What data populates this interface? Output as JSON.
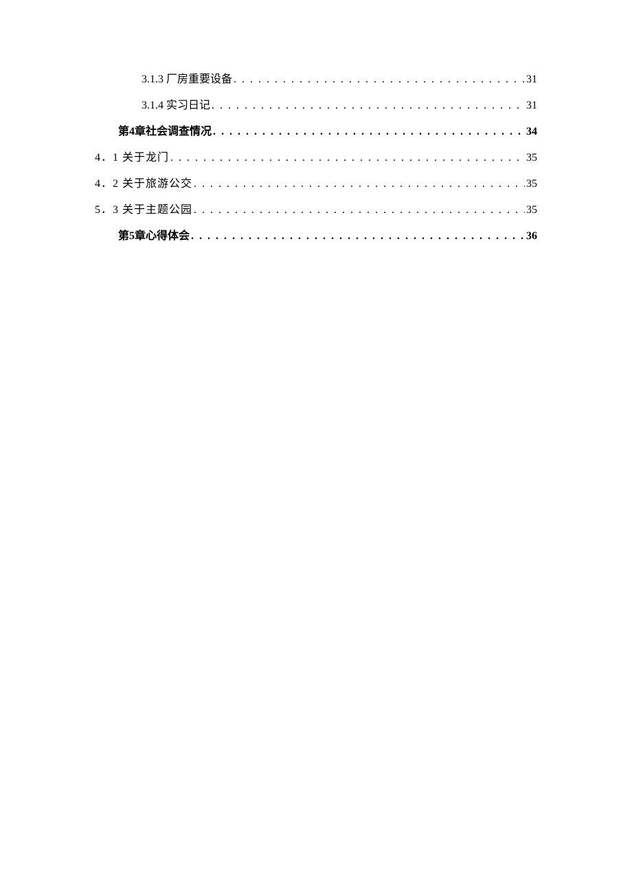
{
  "toc": {
    "entries": [
      {
        "indent": "indent-1",
        "bold": false,
        "label": "3.1.3  厂房重要设备",
        "page": "31"
      },
      {
        "indent": "indent-1",
        "bold": false,
        "label": "3.1.4  实习日记",
        "page": "31"
      },
      {
        "indent": "indent-2",
        "bold": true,
        "label": "第4章社会调查情况",
        "page": "34"
      },
      {
        "indent": "indent-0",
        "bold": false,
        "label": "4．1  关于龙门",
        "page": "35"
      },
      {
        "indent": "indent-0",
        "bold": false,
        "label": "4．2  关于旅游公交",
        "page": "35"
      },
      {
        "indent": "indent-0",
        "bold": false,
        "label": "5．3  关于主题公园",
        "page": "35"
      },
      {
        "indent": "indent-2",
        "bold": true,
        "label": "第5章心得体会",
        "page": "36"
      }
    ]
  }
}
